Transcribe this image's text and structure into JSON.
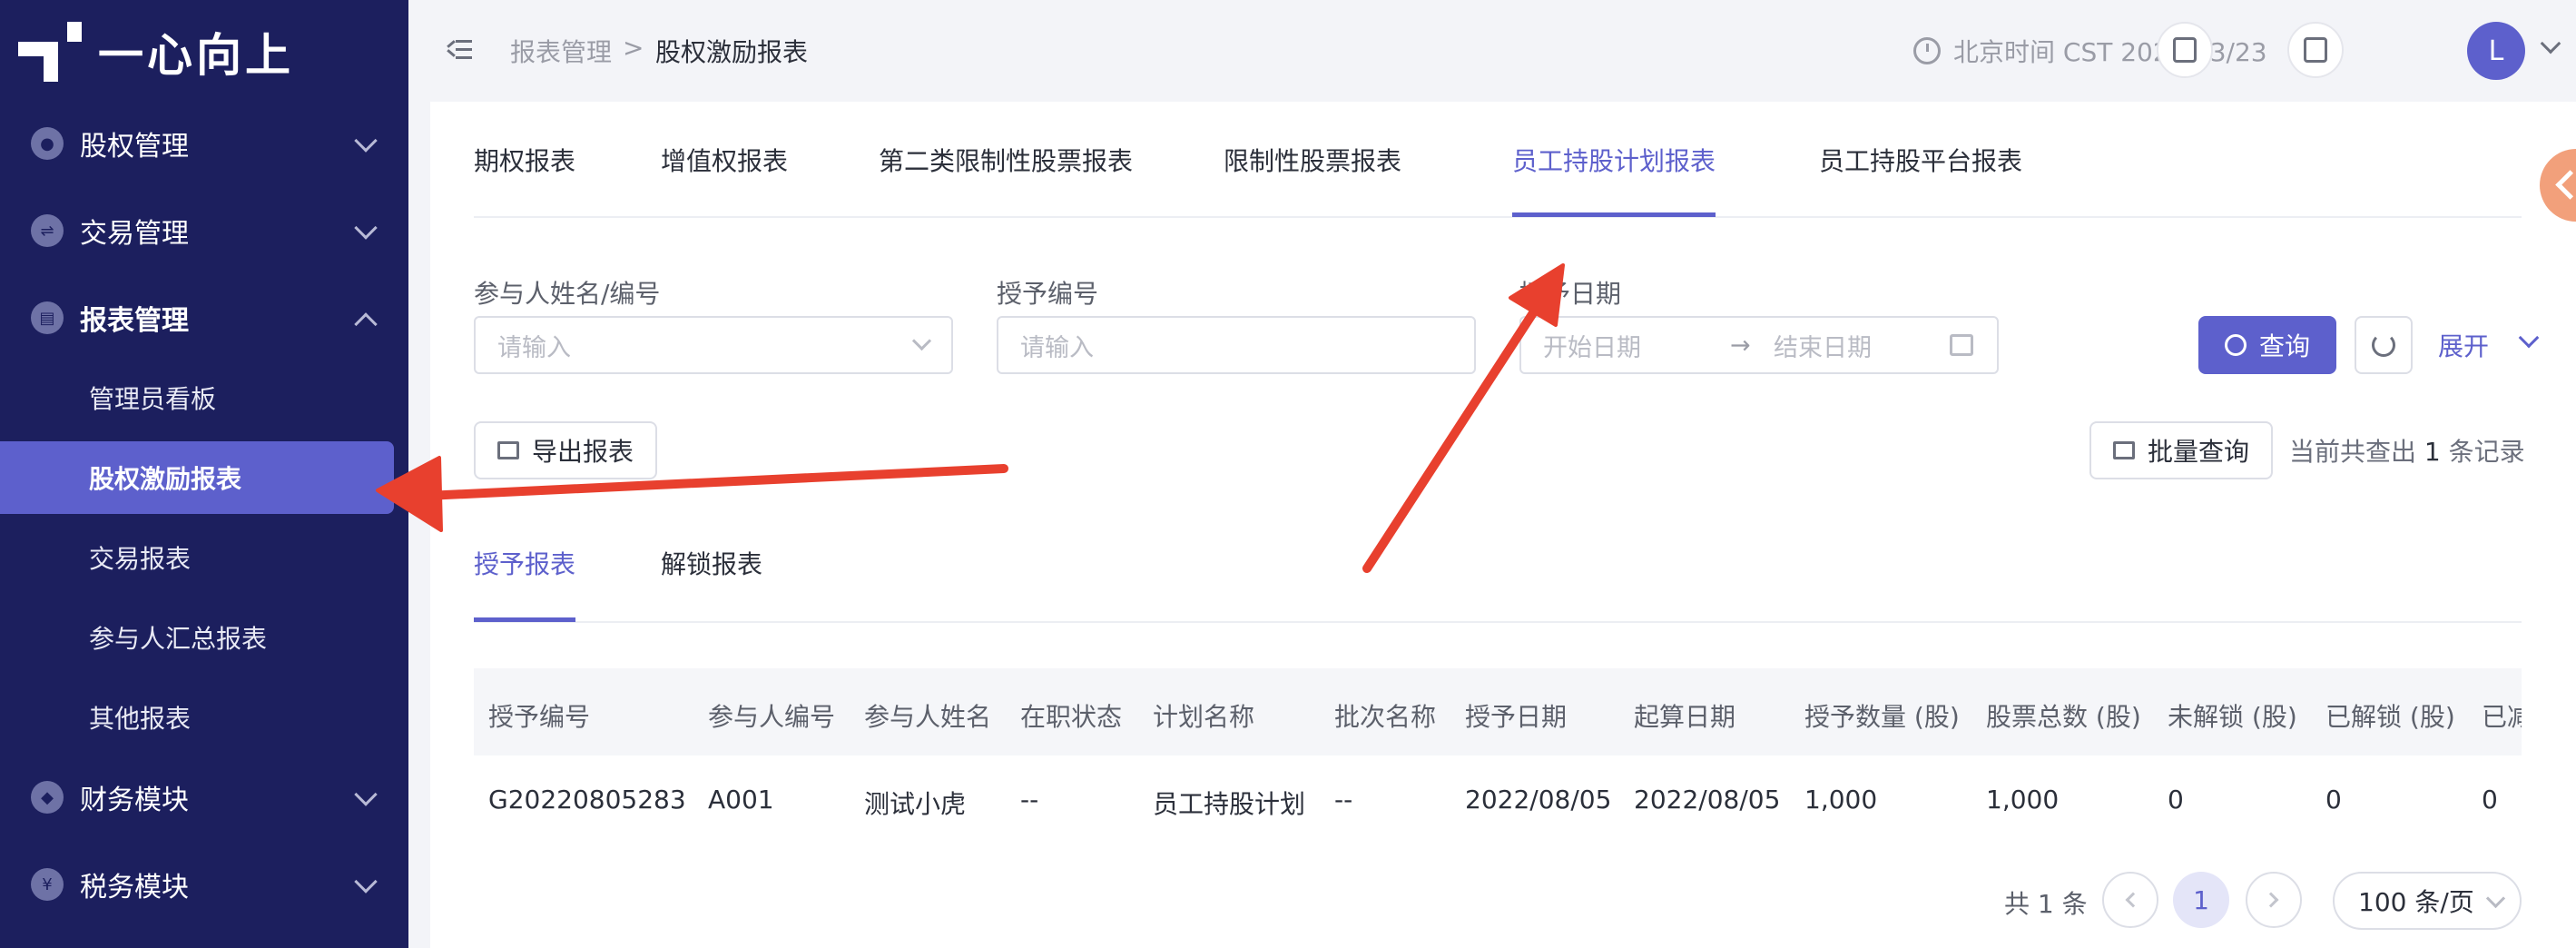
{
  "app": {
    "logo_text": "一心向上"
  },
  "sidebar": {
    "items": [
      {
        "label": "股权管理",
        "icon": "equity-icon",
        "expanded": false
      },
      {
        "label": "交易管理",
        "icon": "trade-icon",
        "expanded": false
      },
      {
        "label": "报表管理",
        "icon": "report-icon",
        "expanded": true
      },
      {
        "label": "财务模块",
        "icon": "finance-icon",
        "expanded": false
      },
      {
        "label": "税务模块",
        "icon": "tax-icon",
        "expanded": false
      }
    ],
    "sub_items": [
      {
        "label": "管理员看板",
        "active": false
      },
      {
        "label": "股权激励报表",
        "active": true
      },
      {
        "label": "交易报表",
        "active": false
      },
      {
        "label": "参与人汇总报表",
        "active": false
      },
      {
        "label": "其他报表",
        "active": false
      }
    ]
  },
  "header": {
    "breadcrumb": [
      "报表管理",
      "股权激励报表"
    ],
    "breadcrumb_sep": ">",
    "time_text": "北京时间 CST 2023/03/23",
    "avatar_letter": "L"
  },
  "tabs": [
    "期权报表",
    "增值权报表",
    "第二类限制性股票报表",
    "限制性股票报表",
    "员工持股计划报表",
    "员工持股平台报表"
  ],
  "active_tab_index": 4,
  "filters": {
    "participant_label": "参与人姓名/编号",
    "participant_placeholder": "请输入",
    "grant_no_label": "授予编号",
    "grant_no_placeholder": "请输入",
    "date_label": "授予日期",
    "date_start_placeholder": "开始日期",
    "date_end_placeholder": "结束日期",
    "date_arrow": "→",
    "query_label": "查询",
    "expand_label": "展开"
  },
  "actions": {
    "export_label": "导出报表",
    "batch_query_label": "批量查询",
    "result_prefix": "当前共查出",
    "result_count": "1",
    "result_suffix": "条记录"
  },
  "sub_tabs": [
    "授予报表",
    "解锁报表"
  ],
  "table": {
    "columns": [
      "授予编号",
      "参与人编号",
      "参与人姓名",
      "在职状态",
      "计划名称",
      "批次名称",
      "授予日期",
      "起算日期",
      "授予数量 (股)",
      "股票总数 (股)",
      "未解锁 (股)",
      "已解锁 (股)",
      "已减"
    ],
    "rows": [
      [
        "G20220805283",
        "A001",
        "测试小虎",
        "--",
        "员工持股计划",
        "--",
        "2022/08/05",
        "2022/08/05",
        "1,000",
        "1,000",
        "0",
        "0",
        "0"
      ]
    ]
  },
  "pagination": {
    "total_text": "共 1 条",
    "current_page": "1",
    "page_size_text": "100 条/页"
  },
  "colors": {
    "sidebar_bg": "#1c1f5e",
    "accent": "#5d60cc",
    "annotation_arrow": "#e8402e"
  }
}
